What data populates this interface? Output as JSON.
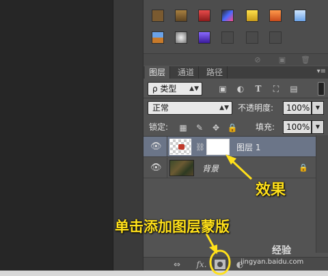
{
  "tabs": [
    "图层",
    "通道",
    "路径"
  ],
  "filter": {
    "kind_label": "ρ 类型"
  },
  "blend": {
    "mode": "正常",
    "opacity_label": "不透明度:",
    "opacity_value": "100%",
    "lock_label": "锁定:",
    "fill_label": "填充:",
    "fill_value": "100%"
  },
  "layers": [
    {
      "name": "图层 1",
      "selected": true,
      "has_mask": true
    },
    {
      "name": "背景",
      "selected": false,
      "locked": true
    }
  ],
  "annotations": {
    "effect": "效果",
    "add_mask": "单击添加图层蒙版"
  },
  "watermark": {
    "text": "经验",
    "url": "jingyan.baidu.com"
  },
  "bottom_icons": [
    "link-icon",
    "fx-icon",
    "mask-icon",
    "adjustment-icon"
  ],
  "accent_color": "#ffe01a"
}
